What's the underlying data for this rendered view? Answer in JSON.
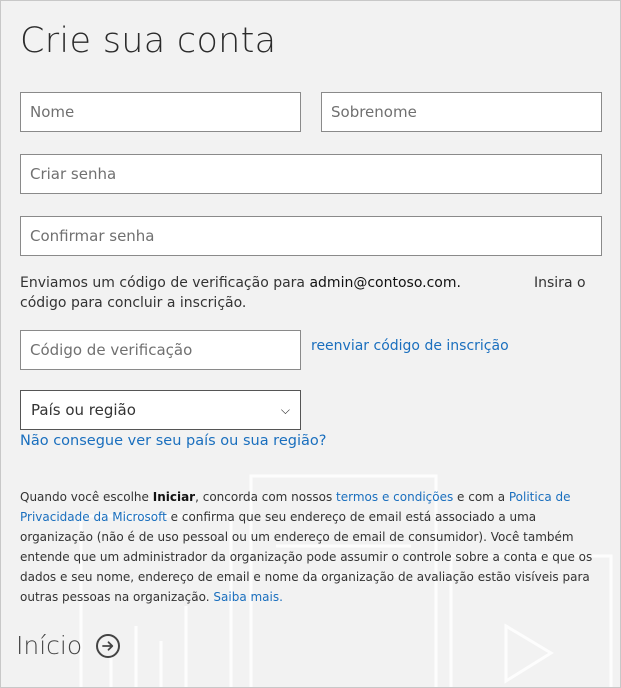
{
  "title": "Crie sua conta",
  "fields": {
    "first_name": {
      "placeholder": "Nome",
      "value": ""
    },
    "last_name": {
      "placeholder": "Sobrenome",
      "value": ""
    },
    "password": {
      "placeholder": "Criar senha",
      "value": ""
    },
    "confirm_password": {
      "placeholder": "Confirmar senha",
      "value": ""
    },
    "verification_code": {
      "placeholder": "Código de verificação",
      "value": ""
    }
  },
  "verification": {
    "prefix": "Enviamos um código de verificação para",
    "email": "admin@contoso.com.",
    "suffix_a": "Insira o",
    "suffix_b": "código para concluir a inscrição.",
    "resend_link": "reenviar código de inscrição"
  },
  "country": {
    "selected": "País ou região",
    "help_link": "Não consegue ver seu país ou sua região?"
  },
  "legal": {
    "t1": "Quando você escolhe ",
    "bold": "Iniciar",
    "t2": ", concorda com nossos ",
    "terms_link": "termos e condições",
    "t3": " e com a ",
    "privacy_link": "Politica de Privacidade da Microsoft",
    "t4": " e confirma que seu endereço de email está associado a uma organização (não é de uso pessoal ou um endereço de email de consumidor). Você também entende que um administrador da organização pode assumir o controle sobre a conta e que os dados e seu nome, endereço de email e nome da organização de avaliação estão visíveis para outras pessoas na organização. ",
    "more_link": "Saiba mais."
  },
  "start": {
    "label": "Início",
    "icon": "arrow-right-circle-icon"
  },
  "colors": {
    "background": "#f2f2f2",
    "link": "#1a6fbe",
    "border": "#8a8a8a"
  }
}
